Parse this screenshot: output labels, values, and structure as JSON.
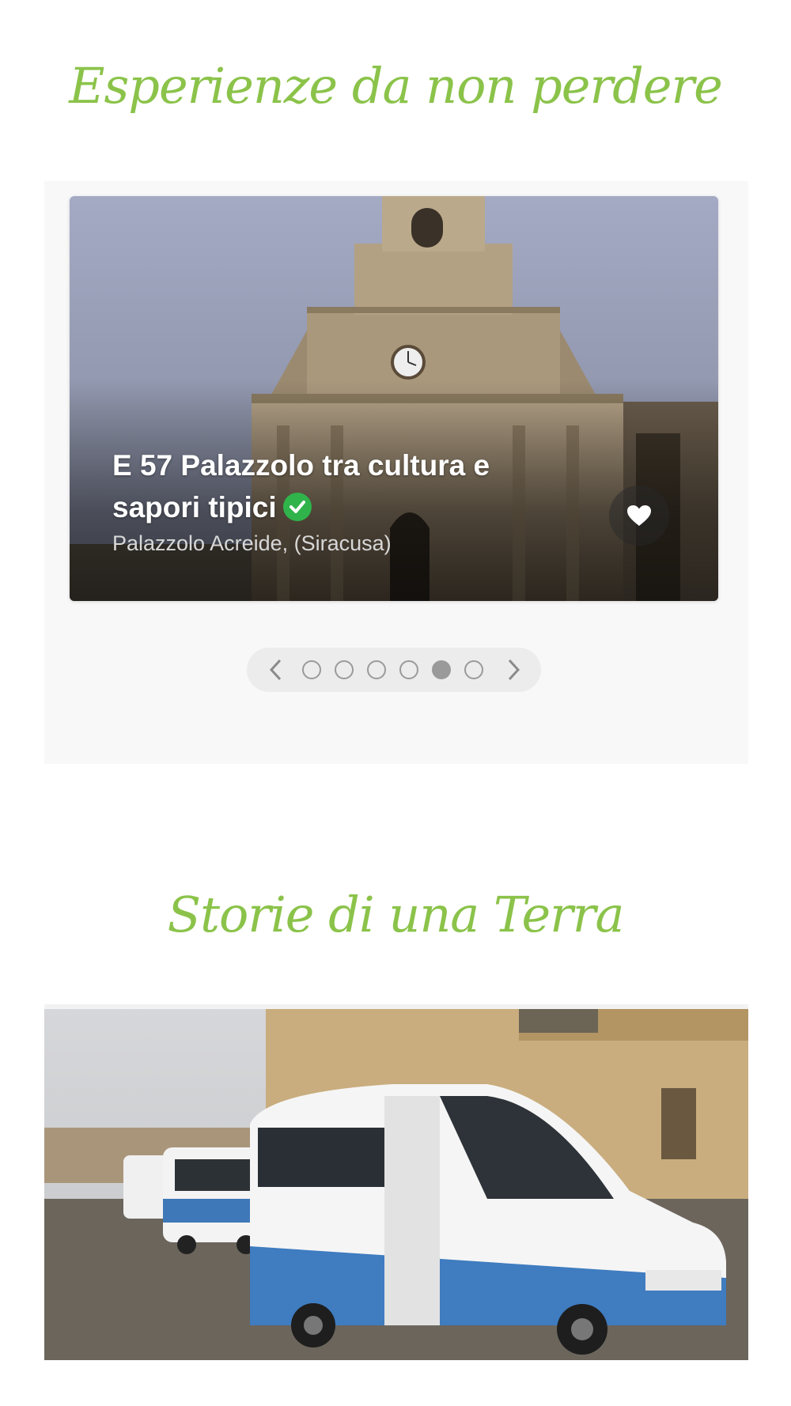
{
  "sections": {
    "experiences_title": "Esperienze da non perdere",
    "stories_title": "Storie di una Terra"
  },
  "experience_card": {
    "title": "E 57 Palazzolo tra cultura e sapori tipici",
    "location": "Palazzolo Acreide, (Siracusa)",
    "verified_icon": "check-circle-icon",
    "favorite_icon": "heart-icon"
  },
  "pager": {
    "prev_icon": "chevron-left-icon",
    "next_icon": "chevron-right-icon",
    "dot_count": 6,
    "active_index": 4
  },
  "story_card": {
    "image": "minibus-photo"
  },
  "colors": {
    "accent": "#8bc34a",
    "verified": "#2fb34a",
    "pager_bg": "#ececec",
    "dot": "#9a9a9a"
  }
}
